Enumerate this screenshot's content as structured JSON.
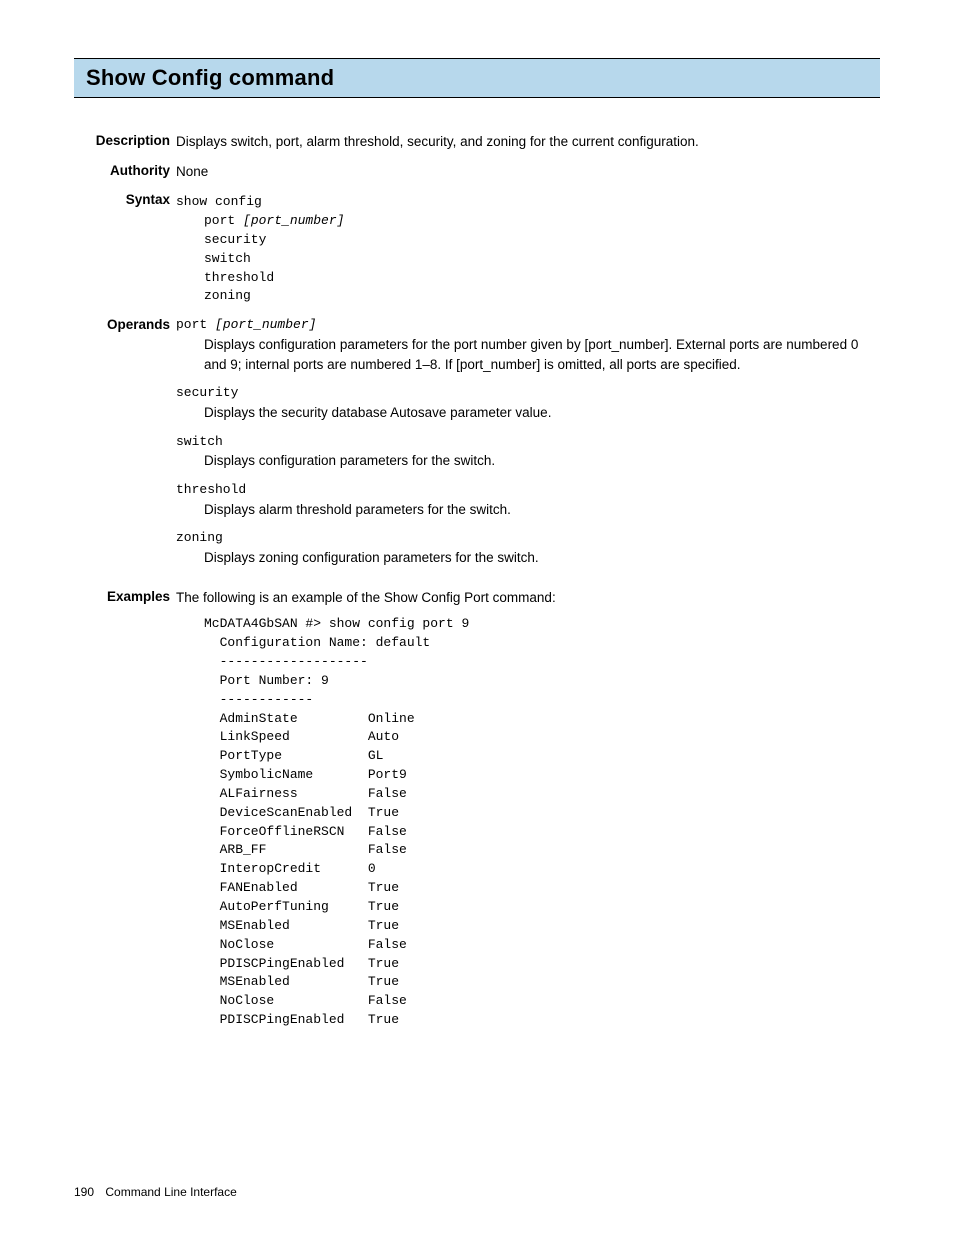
{
  "title": "Show Config command",
  "description": {
    "label": "Description",
    "text": "Displays switch, port, alarm threshold, security, and zoning for the current configuration."
  },
  "authority": {
    "label": "Authority",
    "text": "None"
  },
  "syntax": {
    "label": "Syntax",
    "cmd": "show config",
    "lines": [
      {
        "plain": "port ",
        "italic": "[port_number]"
      },
      {
        "plain": "security"
      },
      {
        "plain": "switch"
      },
      {
        "plain": "threshold"
      },
      {
        "plain": "zoning"
      }
    ]
  },
  "operands": {
    "label": "Operands",
    "items": [
      {
        "name_plain": "port ",
        "name_italic": "[port_number]",
        "desc": "Displays configuration parameters for the port number given by [port_number]. External ports are numbered 0 and 9; internal ports are numbered 1–8. If [port_number] is omitted, all ports are specified."
      },
      {
        "name_plain": "security",
        "desc": "Displays the security database Autosave parameter value."
      },
      {
        "name_plain": "switch",
        "desc": "Displays configuration parameters for the switch."
      },
      {
        "name_plain": "threshold",
        "desc": "Displays alarm threshold parameters for the switch."
      },
      {
        "name_plain": "zoning",
        "desc": "Displays zoning configuration parameters for the switch."
      }
    ]
  },
  "examples": {
    "label": "Examples",
    "intro": "The following is an example of the Show Config Port command:",
    "output": "McDATA4GbSAN #> show config port 9\n  Configuration Name: default\n  -------------------\n  Port Number: 9\n  ------------\n  AdminState         Online\n  LinkSpeed          Auto\n  PortType           GL\n  SymbolicName       Port9\n  ALFairness         False\n  DeviceScanEnabled  True\n  ForceOfflineRSCN   False\n  ARB_FF             False\n  InteropCredit      0\n  FANEnabled         True\n  AutoPerfTuning     True\n  MSEnabled          True\n  NoClose            False\n  PDISCPingEnabled   True\n  MSEnabled          True\n  NoClose            False\n  PDISCPingEnabled   True"
  },
  "footer": {
    "page": "190",
    "section": "Command Line Interface"
  }
}
